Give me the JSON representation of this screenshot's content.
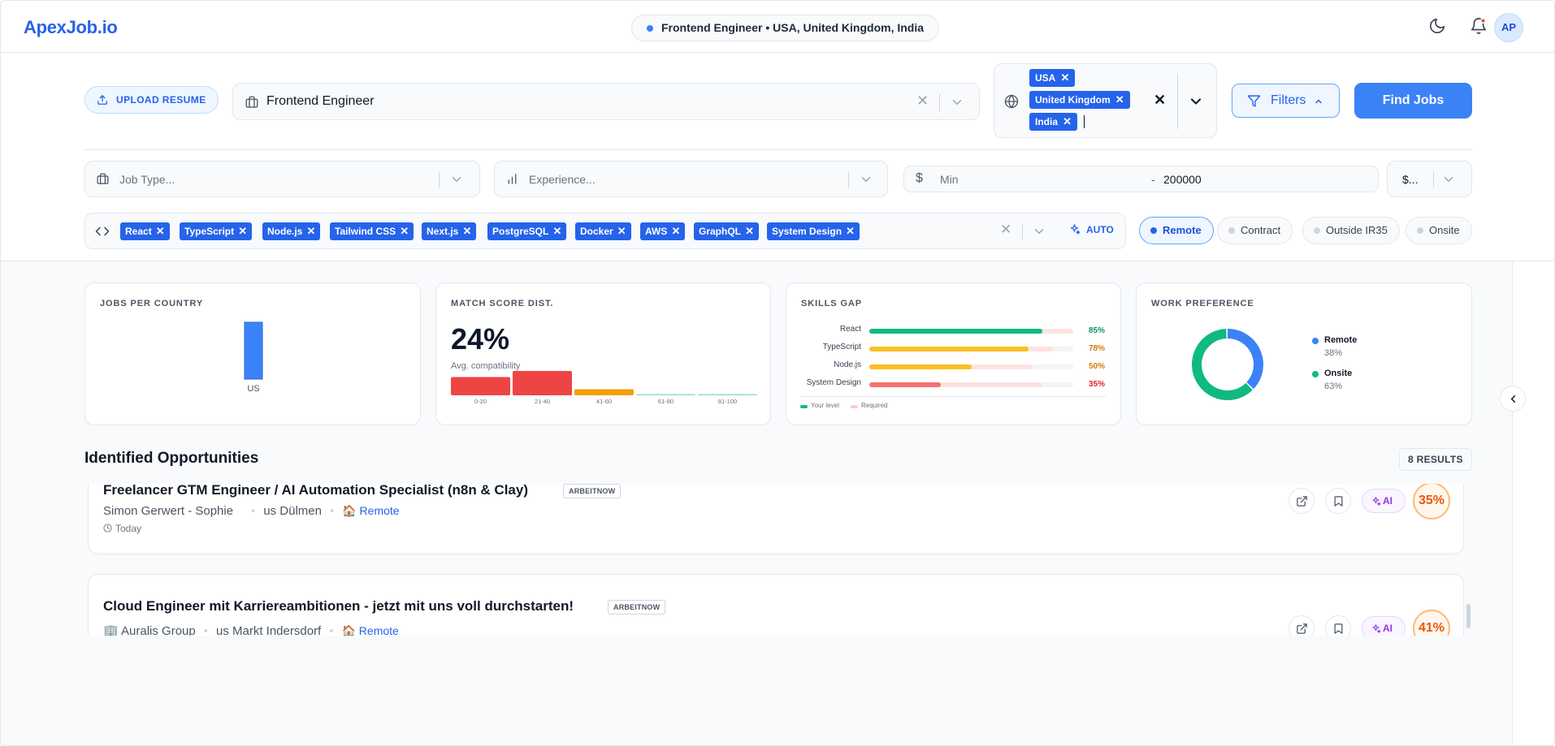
{
  "app": {
    "logo": "ApexJob.io"
  },
  "header": {
    "context": "Frontend Engineer • USA, United Kingdom, India",
    "avatar_initials": "AP"
  },
  "search": {
    "upload_label": "UPLOAD RESUME",
    "role_value": "Frontend Engineer",
    "countries": [
      "USA",
      "United Kingdom",
      "India"
    ],
    "filters_label": "Filters",
    "find_label": "Find Jobs",
    "job_type_placeholder": "Job Type...",
    "experience_placeholder": "Experience...",
    "salary_min_placeholder": "Min",
    "salary_dash": "-",
    "salary_max_value": "200000",
    "currency_value": "$...",
    "skills": [
      "React",
      "TypeScript",
      "Node.js",
      "Tailwind CSS",
      "Next.js",
      "PostgreSQL",
      "Docker",
      "AWS",
      "GraphQL",
      "System Design"
    ],
    "auto_label": "AUTO",
    "work_prefs": [
      {
        "label": "Remote",
        "active": true
      },
      {
        "label": "Contract",
        "active": false
      },
      {
        "label": "Outside IR35",
        "active": false
      },
      {
        "label": "Onsite",
        "active": false
      }
    ]
  },
  "stats": {
    "jobs_per_country": {
      "title": "JOBS PER COUNTRY",
      "chart_data": {
        "type": "bar",
        "categories": [
          "US"
        ],
        "values": [
          1
        ]
      }
    },
    "match_score": {
      "title": "MATCH SCORE DIST.",
      "value": "24%",
      "subtitle": "Avg. compatibility",
      "chart_data": {
        "type": "bar",
        "categories": [
          "0-20",
          "21-40",
          "41-60",
          "61-80",
          "81-100"
        ],
        "values": [
          3,
          4,
          1,
          0,
          0
        ],
        "colors": [
          "#ef4444",
          "#ef4444",
          "#f59e0b",
          "#22c55e",
          "#22c55e"
        ]
      }
    },
    "skills_gap": {
      "title": "SKILLS GAP",
      "chart_data": {
        "type": "bar",
        "categories": [
          "React",
          "TypeScript",
          "Node.js",
          "System Design"
        ],
        "series": [
          {
            "name": "Your level",
            "values": [
              85,
              78,
              50,
              35
            ]
          },
          {
            "name": "Required",
            "values": [
              100,
              90,
              80,
              85
            ]
          }
        ],
        "value_labels": [
          "85%",
          "78%",
          "50%",
          "35%"
        ],
        "colors": [
          "#10b981",
          "#fbbf24",
          "#fbbf24",
          "#f87171"
        ],
        "pct_colors": [
          "#059669",
          "#d97706",
          "#d97706",
          "#dc2626"
        ]
      },
      "legend_you": "Your level",
      "legend_req": "Required"
    },
    "work_preference": {
      "title": "WORK PREFERENCE",
      "chart_data": {
        "type": "pie",
        "categories": [
          "Remote",
          "Onsite"
        ],
        "values": [
          38,
          63
        ],
        "colors": [
          "#3b82f6",
          "#10b981"
        ]
      },
      "legend": [
        {
          "label": "Remote",
          "pct": "38%"
        },
        {
          "label": "Onsite",
          "pct": "63%"
        }
      ]
    }
  },
  "opportunities": {
    "title": "Identified Opportunities",
    "results": "8 RESULTS",
    "jobs": [
      {
        "title": "Freelancer GTM Engineer / AI Automation Specialist (n8n & Clay)",
        "source": "ARBEITNOW",
        "company": "Simon Gerwert - Sophie",
        "location": "us Dülmen",
        "remote": "🏠 Remote",
        "time": "Today",
        "ai": "AI",
        "score": "35%"
      },
      {
        "title": "Cloud Engineer mit Karriereambitionen - jetzt mit uns voll durchstarten!",
        "source": "ARBEITNOW",
        "company": "🏢 Auralis Group",
        "location": "us Markt Indersdorf",
        "remote": "🏠 Remote",
        "time": "",
        "ai": "AI",
        "score": "41%"
      }
    ]
  }
}
